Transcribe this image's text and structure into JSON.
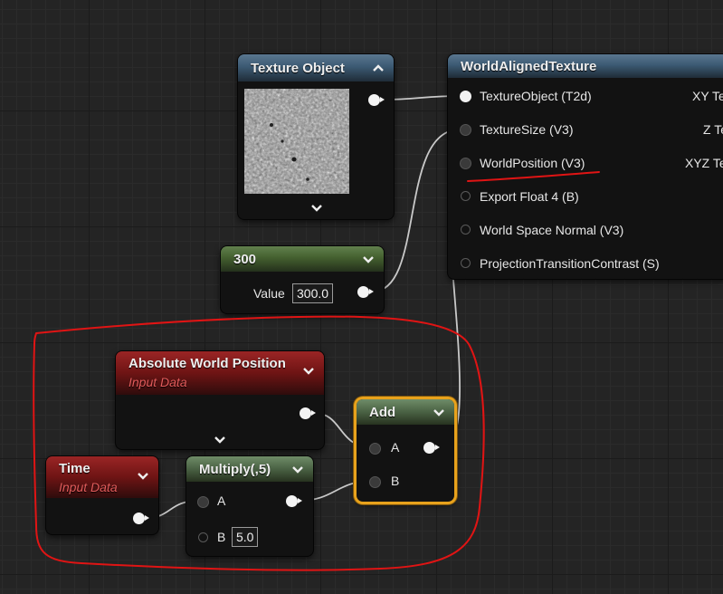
{
  "nodes": {
    "texture_object": {
      "title": "Texture Object"
    },
    "world_aligned": {
      "title": "WorldAlignedTexture",
      "inputs": [
        "TextureObject (T2d)",
        "TextureSize (V3)",
        "WorldPosition (V3)",
        "Export Float 4 (B)",
        "World Space Normal (V3)",
        "ProjectionTransitionContrast (S)"
      ],
      "outputs": [
        "XY Te",
        "Z Te",
        "XYZ Te"
      ]
    },
    "constant": {
      "title": "300",
      "value_label": "Value",
      "value": "300.0"
    },
    "abs_world_pos": {
      "title": "Absolute World Position",
      "subtitle": "Input Data"
    },
    "time": {
      "title": "Time",
      "subtitle": "Input Data"
    },
    "multiply": {
      "title": "Multiply(,5)",
      "pin_a": "A",
      "pin_b": "B",
      "b_value": "5.0"
    },
    "add": {
      "title": "Add",
      "pin_a": "A",
      "pin_b": "B"
    }
  },
  "colors": {
    "canvas": "#242424",
    "annotation": "#e01414",
    "selection": "#e8a21c",
    "wire": "#c8c8c8"
  },
  "icons": [
    "chevron-up-icon",
    "chevron-down-icon",
    "texture-thumbnail"
  ]
}
